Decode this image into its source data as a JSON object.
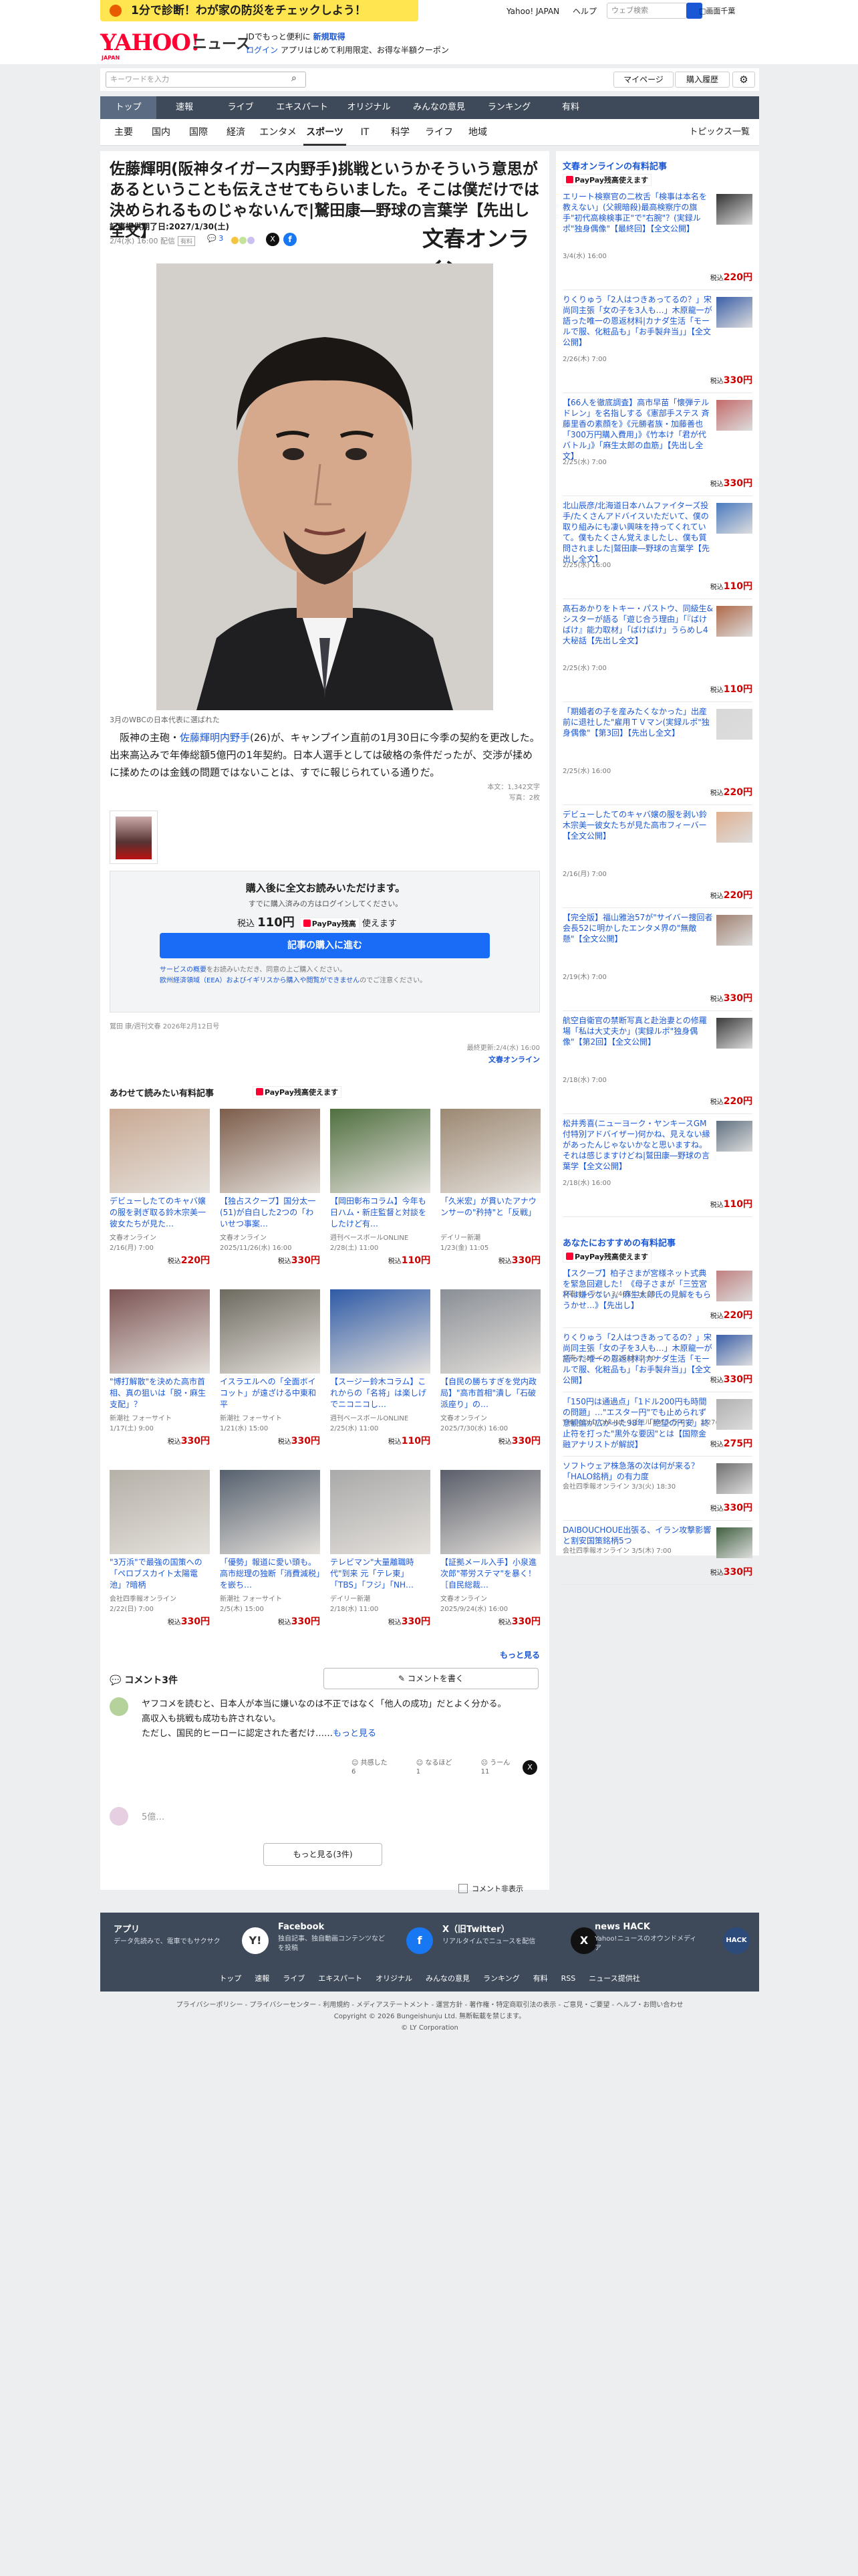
{
  "promo": {
    "text": "1分で診断！わが家の防災をチェックしよう！"
  },
  "toplinks": {
    "items": [
      "Yahoo! JAPAN",
      "ヘルプ"
    ],
    "search_placeholder": "ウェブ検索",
    "checkbox": "□画面千葉"
  },
  "header": {
    "logo": "YAHOO!",
    "logo_sub": "JAPAN",
    "news": "ニュース",
    "line1_prefix": "IDでもっと便利に",
    "line1_link": "新規取得",
    "line2_login": "ログイン",
    "line2_text": "アプリはじめて利用限定、お得な半額クーポン"
  },
  "search": {
    "placeholder": "キーワードを入力",
    "mypage": "マイページ",
    "purchase": "購入履歴"
  },
  "nav": [
    "トップ",
    "速報",
    "ライブ",
    "エキスパート",
    "オリジナル",
    "みんなの意見",
    "ランキング",
    "有料"
  ],
  "subnav": [
    "主要",
    "国内",
    "国際",
    "経済",
    "エンタメ",
    "スポーツ",
    "IT",
    "科学",
    "ライフ",
    "地域"
  ],
  "subnav_active": "スポーツ",
  "topics": "トピックス一覧",
  "article": {
    "title": "佐藤輝明(阪神タイガース内野手)挑戦というかそういう意思があるということも伝えさせてもらいました。そこは僕だけでは決められるものじゃないんで|鷲田康―野球の言葉学【先出し全文】",
    "period": "記事提供期了日:2027/1/30(土)",
    "date": "2/4(水) 16:00 配信",
    "badge": "有料",
    "comments": "3",
    "publisher": "文春オンライン",
    "caption": "3月のWBCの日本代表に選ばれた",
    "lead_pre": "阪神の主砲・",
    "lead_link": "佐藤輝明内野手",
    "lead_post": "(26)が、キャンプイン直前の1月30日に今季の契約を更改した。出来高込みで年俸総額5億円の1年契約。日本人選手としては破格の条件だったが、交渉が揉めに揉めたのは金銭の問題ではないことは、すでに報じられている通りだ。",
    "wordcount": "本文：1,342文字",
    "photos": "写真：2枚",
    "source": "鷲田 康/週刊文春 2026年2月12日号",
    "updated": "最終更新:2/4(水) 16:00"
  },
  "paywall": {
    "title": "購入後に全文お読みいただけます。",
    "sub": "すでに購入済みの方はログインしてください。",
    "price_label": "税込",
    "price": "110円",
    "paypay": "PayPay残高",
    "paypay_tail": "使えます",
    "button": "記事の購入に進む",
    "note1": "サービスの概要",
    "note2": "をお読みいただき、同意の上ご購入ください。",
    "note3": "欧州経済領域（EEA）およびイギリスから購入や閲覧ができません",
    "note4": "のでご注意ください。"
  },
  "related": {
    "heading": "あわせて読みたい有料記事",
    "paypay": "PayPay残高使えます",
    "cards": [
      {
        "title": "デビューしたてのキャバ嬢の服を剥ぎ取る鈴木宗美一彼女たちが見た…",
        "pub": "文春オンライン",
        "date": "2/16(月) 7:00",
        "price": "220円"
      },
      {
        "title": "【独占スクープ】国分太一(51)が自白した2つの「わいせつ事案…",
        "pub": "文春オンライン",
        "date": "2025/11/26(水) 16:00",
        "price": "330円"
      },
      {
        "title": "【岡田彰布コラム】今年も日ハム・新庄監督と対談をしたけど有…",
        "pub": "週刊ベースボールONLINE",
        "date": "2/28(土) 11:00",
        "price": "110円"
      },
      {
        "title": "「久米宏」が貫いたアナウンサーの\"矜持\"と「反戦」",
        "pub": "デイリー新潮",
        "date": "1/23(金) 11:05",
        "price": "330円"
      },
      {
        "title": "\"博打解散\"を決めた高市首相、真の狙いは「脱・麻生支配」？",
        "pub": "新潮社 フォーサイト",
        "date": "1/17(土) 9:00",
        "price": "330円"
      },
      {
        "title": "イスラエルへの「全面ボイコット」が遠ざける中東和平",
        "pub": "新潮社 フォーサイト",
        "date": "1/21(水) 15:00",
        "price": "330円"
      },
      {
        "title": "【スージー鈴木コラム】これからの「名将」は楽しげでニコニコし…",
        "pub": "週刊ベースボールONLINE",
        "date": "2/25(水) 11:00",
        "price": "110円"
      },
      {
        "title": "【自民の勝ちすぎを党内政局】\"高市首相\"潰し「石破派座り」の…",
        "pub": "文春オンライン",
        "date": "2025/7/30(水) 16:00",
        "price": "330円"
      },
      {
        "title": "\"3万浜\"で最強の国策への「ペロブスカイト太陽電池」?暗柄",
        "pub": "会社四季報オンライン",
        "date": "2/22(日) 7:00",
        "price": "330円"
      },
      {
        "title": "「優勢」報道に愛い頭も。高市総理の独断「消費減税」を嵌ち…",
        "pub": "新潮社 フォーサイト",
        "date": "2/5(木) 15:00",
        "price": "330円"
      },
      {
        "title": "テレビマン\"大量離職時代\"到来 元「テレ東」「TBS」「フジ」「NH…",
        "pub": "デイリー新潮",
        "date": "2/18(水) 11:00",
        "price": "330円"
      },
      {
        "title": "【証拠メール入手】小泉進次郎\"帯労ステマ\"を暴く！［自民総裁…",
        "pub": "文春オンライン",
        "date": "2025/9/24(水) 16:00",
        "price": "330円"
      }
    ],
    "more": "もっと見る"
  },
  "comments": {
    "heading": "コメント3件",
    "write": "コメントを書く",
    "body": "ヤフコメを読むと、日本人が本当に嫌いなのは不正ではなく「他人の成功」だとよく分かる。\n高収入も挑戦も成功も許されない。\nただし、国民的ヒーローに認定された者だけ……",
    "more_link": "もっと見る",
    "reactions": [
      {
        "label": "共感した",
        "count": "6"
      },
      {
        "label": "なるほど",
        "count": "1"
      },
      {
        "label": "うーん",
        "count": "11"
      }
    ],
    "second": "5億…",
    "show_more": "もっと見る(3件)",
    "hide": "コメント非表示"
  },
  "sidebar": {
    "heading": "文春オンラインの有料記事",
    "paypay": "PayPay残高使えます",
    "items": [
      {
        "title": "エリート検察官の二枚舌「検事は本名を教えない」(父親暗殺)最高検察庁の旗手\"初代高検検事正\"で\"右腕\"？(実録ルポ\"独身偶像\"【最終回】【全文公開】",
        "date": "3/4(水) 16:00",
        "price": "220円"
      },
      {
        "title": "りくりゅう「2人はつきあってるの？」宋尚同主張「女の子を3人も…」木原龍一が語った唯一の恩返材料|カナダ生活「モールで服、化粧品も」「お手製弁当」」【全文公開】",
        "date": "2/26(木) 7:00",
        "price": "330円"
      },
      {
        "title": "【66人を徹底調査】高市早苗「懐弾テルドレン」を名指しする《憲部手ステス 斉藤里香の素顔を》《元勝者族・加藤善也「300万円購入費用」》《竹本け「君が代バトル」》「麻生太郎の血筋」【先出し全文】",
        "date": "2/25(水) 7:00",
        "price": "330円"
      },
      {
        "title": "北山辰彦/北海道日本ハムファイターズ投手/たくさんアドバイスいただいて、僕の取り組みにも凄い興味を持ってくれていて。僕もたくさん覚えましたし、僕も質問されました|鷲田康―野球の言葉学【先出し全文】",
        "date": "2/25(水) 16:00",
        "price": "110円"
      },
      {
        "title": "髙石あかりをトキー・パストウ、同級生&シスターが語る「遊じ合う理由」「『ばけばけ』能力取材」「ばけばけ」うらめし4大秘話【先出し全文】",
        "date": "2/25(水) 7:00",
        "price": "110円"
      },
      {
        "title": "「期婚者の子を産みたくなかった」出産前に退社した\"雇用ＴＶマン(実録ルポ\"独身偶像\"【第3回】【先出し全文】",
        "date": "2/25(水) 16:00",
        "price": "220円"
      },
      {
        "title": "デビューしたてのキャバ嬢の服を剥い鈴木宗美一彼女たちが見た高市フィーバー【全文公開】",
        "date": "2/16(月) 7:00",
        "price": "220円"
      },
      {
        "title": "【完全版】福山雅治57が\"サイバー捜回者会長52に明かしたエンタメ界の\"無敵懸\"【全文公開】",
        "date": "2/19(木) 7:00",
        "price": "330円"
      },
      {
        "title": "航空自衛官の禁断写真と赴治妻との修羅場「私は大丈夫か」(実録ルポ\"独身偶像\"【第2回】【全文公開】",
        "date": "2/18(水) 7:00",
        "price": "220円"
      },
      {
        "title": "松井秀喜(ニューヨーク・ヤンキースGM付特別アドバイザー)何かね、見えない縁があったんじゃないかなと思いますね。それは感じますけどね|鷲田康―野球の言葉学【全文公開】",
        "date": "2/18(水) 16:00",
        "price": "110円"
      }
    ],
    "rec_heading": "あなたにおすすめの有料記事",
    "rec_paypay": "PayPay残高使えます",
    "rec_items": [
      {
        "title": "【スクープ】柏子さまが宮様ネット式典を緊急回避した！《母子さまが「三笠宮杯は嫌らない」。麻生太郎氏の見解をもらうかせ…》【先出し】",
        "date": "文春オンライン 3/4(水) 16:00",
        "price": "220円"
      },
      {
        "title": "りくりゅう「2人はつきあってるの？」宋尚同主張「女の子を3人も…」木原龍一が語った唯一の恩返材料|カナダ生活「モールで服、化粧品も」「お手製弁当」」【全文公開】",
        "date": "文春オンライン 2/26(木) 7:00",
        "price": "330円"
      },
      {
        "title": "「150円は通過点」「1ドル200円も時間の問題」…\"エスター円\"でも止められず意観論が広がった98年「絶望の円安」終止符を打った\"黒外な要因\"とは【国際金融アナリストが解説】",
        "date": "THE GOLD ONLINE（ゴールドオンライン） 2/27(金) 10:00",
        "price": "275円"
      },
      {
        "title": "ソフトウェア株急落の次は何が来る？「HALO銘柄」の有力度",
        "date": "会社四季報オンライン 3/3(火) 18:30",
        "price": "330円"
      },
      {
        "title": "DAIBOUCHOUE出張る、イラン攻撃影響と割安国策銘柄5つ",
        "date": "会社四季報オンライン 3/5(木) 7:00",
        "price": "330円"
      }
    ]
  },
  "footer": {
    "apps": [
      {
        "name": "アプリ",
        "sub": "データ先読みで、電車でもサクサク",
        "icon": "Y!"
      },
      {
        "name": "Facebook",
        "sub": "独自記事、独自動画コンテンツなどを投稿",
        "icon": "f"
      },
      {
        "name": "X（旧Twitter）",
        "sub": "リアルタイムでニュースを配信",
        "icon": "X"
      },
      {
        "name": "news HACK",
        "sub": "Yahoo!ニュースのオウンドメディア",
        "icon": "HACK"
      }
    ],
    "links": [
      "トップ",
      "速報",
      "ライブ",
      "エキスパート",
      "オリジナル",
      "みんなの意見",
      "ランキング",
      "有料",
      "RSS",
      "ニュース提供社"
    ],
    "legal1": "プライバシーポリシー - プライバシーセンター - 利用規約 - メディアステートメント - 運営方針 - 著作権・特定商取引法の表示 - ご意見・ご要望 - ヘルプ・お問い合わせ",
    "legal2": "Copyright © 2026 Bungeishunju Ltd. 無断転載を禁じます。",
    "legal3": "© LY Corporation"
  }
}
